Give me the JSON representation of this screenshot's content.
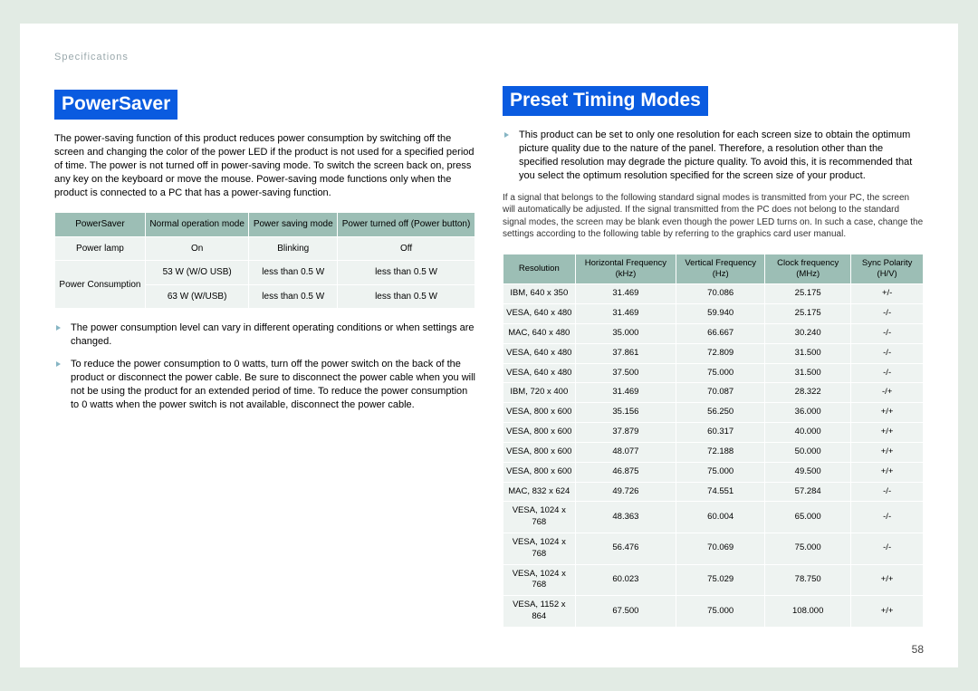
{
  "breadcrumb": "Specifications",
  "page_number": "58",
  "left": {
    "heading": "PowerSaver",
    "intro": "The power-saving function of this product reduces power consumption by switching off the screen and changing the color of the power LED if the product is not used for a specified period of time. The power is not turned off in power-saving mode. To switch the screen back on, press any key on the keyboard or move the mouse. Power-saving mode functions only when the product is connected to a PC that has a power-saving function.",
    "table": {
      "headers": [
        "PowerSaver",
        "Normal operation mode",
        "Power saving mode",
        "Power turned off (Power button)"
      ],
      "rows": [
        [
          "Power lamp",
          "On",
          "Blinking",
          "Off"
        ],
        [
          "Power Consumption",
          "53 W (W/O USB)",
          "less than 0.5 W",
          "less than 0.5 W"
        ],
        [
          "",
          "63 W (W/USB)",
          "less than 0.5 W",
          "less than 0.5 W"
        ]
      ]
    },
    "notes": [
      "The power consumption level can vary in different operating conditions or when settings are changed.",
      "To reduce the power consumption to 0 watts, turn off the power switch on the back of the product or disconnect the power cable. Be sure to disconnect the power cable when you will not be using the product for an extended period of time. To reduce the power consumption to 0 watts when the power switch is not available, disconnect the power cable."
    ]
  },
  "right": {
    "heading": "Preset Timing Modes",
    "bullets": [
      "This product can be set to only one resolution for each screen size to obtain the optimum picture quality due to the nature of the panel. Therefore, a resolution other than the specified resolution may degrade the picture quality. To avoid this, it is recommended that you select the optimum resolution specified for the screen size of your product."
    ],
    "small_note": "If a signal that belongs to the following standard signal modes is transmitted from your PC, the screen will automatically be adjusted. If the signal transmitted from the PC does not belong to the standard signal modes, the screen may be blank even though the power LED turns on. In such a case, change the settings according to the following table by referring to the graphics card user manual.",
    "table": {
      "headers": [
        "Resolution",
        "Horizontal Frequency (kHz)",
        "Vertical Frequency (Hz)",
        "Clock frequency (MHz)",
        "Sync Polarity (H/V)"
      ],
      "rows": [
        [
          "IBM, 640 x 350",
          "31.469",
          "70.086",
          "25.175",
          "+/-"
        ],
        [
          "VESA, 640 x 480",
          "31.469",
          "59.940",
          "25.175",
          "-/-"
        ],
        [
          "MAC, 640 x 480",
          "35.000",
          "66.667",
          "30.240",
          "-/-"
        ],
        [
          "VESA, 640 x 480",
          "37.861",
          "72.809",
          "31.500",
          "-/-"
        ],
        [
          "VESA, 640 x 480",
          "37.500",
          "75.000",
          "31.500",
          "-/-"
        ],
        [
          "IBM, 720 x 400",
          "31.469",
          "70.087",
          "28.322",
          "-/+"
        ],
        [
          "VESA, 800 x 600",
          "35.156",
          "56.250",
          "36.000",
          "+/+"
        ],
        [
          "VESA, 800 x 600",
          "37.879",
          "60.317",
          "40.000",
          "+/+"
        ],
        [
          "VESA, 800 x 600",
          "48.077",
          "72.188",
          "50.000",
          "+/+"
        ],
        [
          "VESA, 800 x 600",
          "46.875",
          "75.000",
          "49.500",
          "+/+"
        ],
        [
          "MAC, 832 x 624",
          "49.726",
          "74.551",
          "57.284",
          "-/-"
        ],
        [
          "VESA, 1024 x 768",
          "48.363",
          "60.004",
          "65.000",
          "-/-"
        ],
        [
          "VESA, 1024 x 768",
          "56.476",
          "70.069",
          "75.000",
          "-/-"
        ],
        [
          "VESA, 1024 x 768",
          "60.023",
          "75.029",
          "78.750",
          "+/+"
        ],
        [
          "VESA, 1152 x 864",
          "67.500",
          "75.000",
          "108.000",
          "+/+"
        ]
      ]
    }
  }
}
